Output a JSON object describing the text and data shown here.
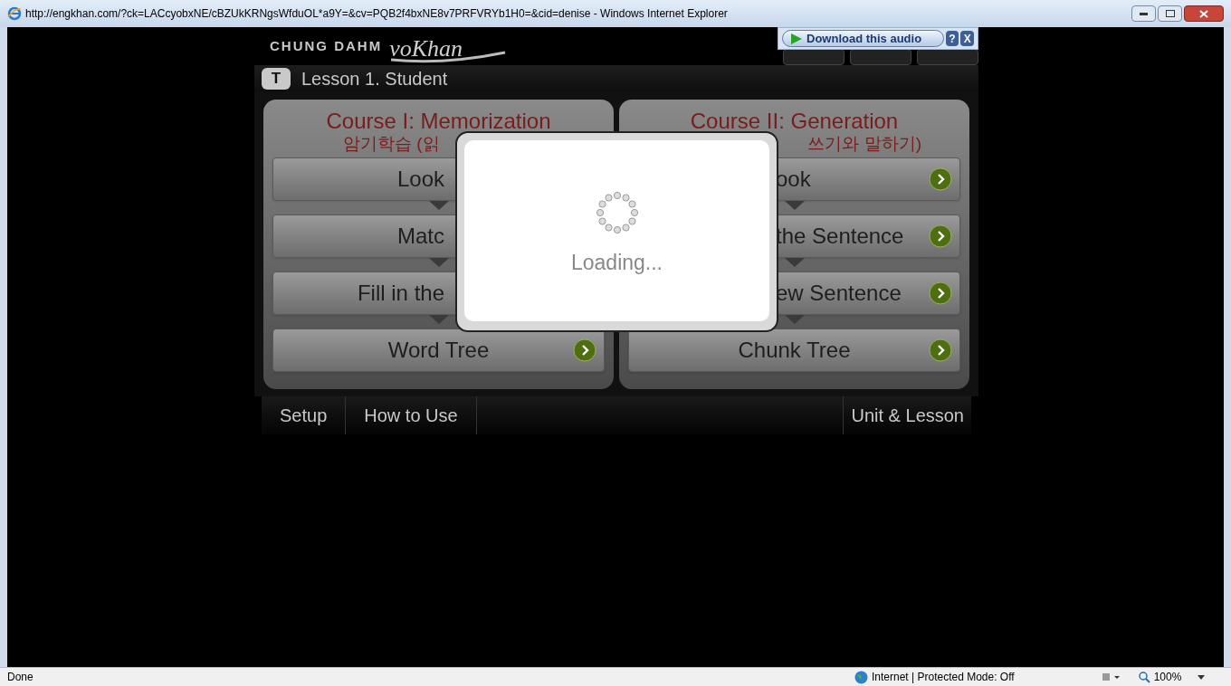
{
  "window": {
    "title": "http://engkhan.com/?ck=LACcyobxNE/cBZUkKRNgsWfduOL*a9Y=&cv=PQB2f4bxNE8v7PRFVRYb1H0=&cid=denise  - Windows Internet Explorer"
  },
  "app": {
    "brand": "CHUNG DAHM",
    "logo_script": "voKhan",
    "download_button": "Download this audio",
    "help_button": "?",
    "close_button": "X",
    "lesson_badge": "T",
    "lesson_title": "Lesson 1. Student",
    "courses": [
      {
        "title": "Course I: Memorization",
        "subtitle": "암기학습 (읽",
        "kind": "memorization",
        "steps": [
          {
            "label": "Look",
            "kind": "partial"
          },
          {
            "label": "Matc",
            "kind": "partial"
          },
          {
            "label": "Fill in the",
            "kind": "partial"
          },
          {
            "label": "Word Tree",
            "kind": "full"
          }
        ]
      },
      {
        "title": "Course II: Generation",
        "subtitle": "쓰기와 말하기)",
        "kind": "generation",
        "steps": [
          {
            "label": "ook",
            "kind": "partial"
          },
          {
            "label": "the Sentence",
            "kind": "partial"
          },
          {
            "label": "ew Sentence",
            "kind": "partial"
          },
          {
            "label": "Chunk Tree",
            "kind": "full"
          }
        ]
      }
    ],
    "footer_left": [
      "Setup",
      "How to Use"
    ],
    "footer_right": "Unit & Lesson"
  },
  "dialog": {
    "message": "Loading..."
  },
  "status_bar": {
    "status": "Done",
    "zone": "Internet | Protected Mode: Off",
    "zoom": "100%"
  }
}
